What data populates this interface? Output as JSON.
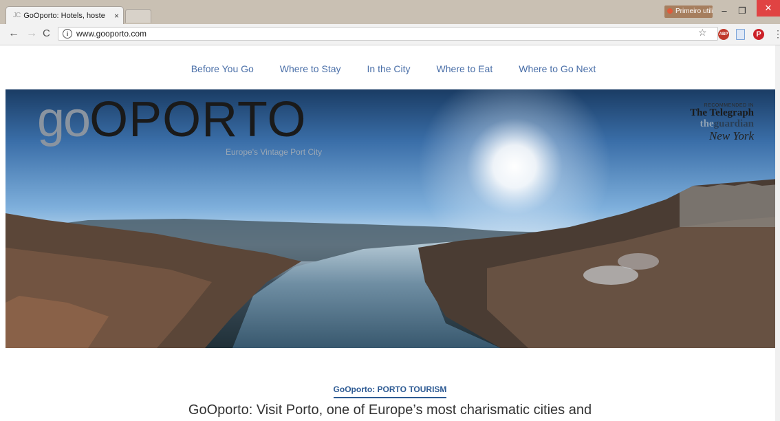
{
  "browser": {
    "tab_title": "GoOporto: Hotels, hoste",
    "tab_favicon": "JC",
    "tab_close": "×",
    "profile_label": "Primeiro utili...",
    "url": "www.gooporto.com",
    "icons": [
      "back-arrow-icon",
      "forward-arrow-icon",
      "reload-icon",
      "info-icon",
      "star-icon",
      "adblock-icon",
      "document-icon",
      "pinterest-icon",
      "menu-dots-icon"
    ]
  },
  "nav": {
    "items": [
      "Before You Go",
      "Where to Stay",
      "In the City",
      "Where to Eat",
      "Where to Go Next"
    ]
  },
  "hero": {
    "logo_go": "go",
    "logo_porto": "OPORTO",
    "tagline": "Europe's Vintage Port City",
    "press_label": "RECOMMENDED IN",
    "press_telegraph": "The Telegraph",
    "press_guardian_the": "the",
    "press_guardian_name": "guardian",
    "press_nyt": "New York"
  },
  "content": {
    "section_heading": "GoOporto: PORTO TOURISM",
    "intro": "GoOporto: Visit Porto, one of Europe’s most charismatic cities and"
  }
}
